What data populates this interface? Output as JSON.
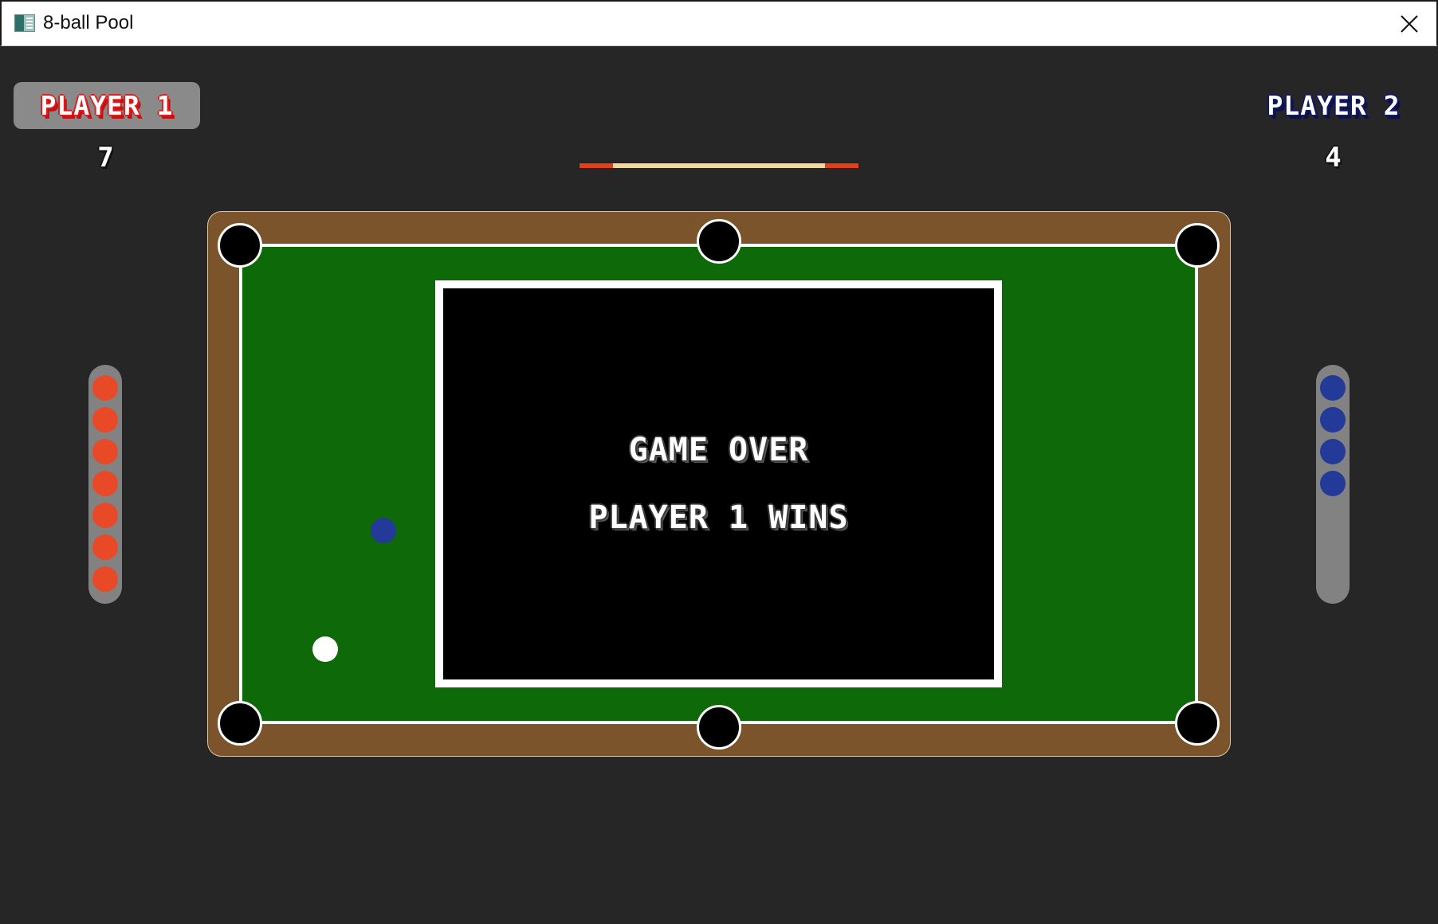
{
  "window": {
    "title": "8-ball Pool",
    "icon": "app-icon",
    "close_icon": "close-icon"
  },
  "players": [
    {
      "name": "PLAYER 1",
      "score": "7",
      "active": true,
      "ball_color": "#e84a27",
      "balls_pocketed": 7
    },
    {
      "name": "PLAYER 2",
      "score": "4",
      "active": false,
      "ball_color": "#233a98",
      "balls_pocketed": 4
    }
  ],
  "overlay": {
    "line1": "GAME OVER",
    "line2": "PLAYER 1 WINS"
  },
  "colors": {
    "background": "#262626",
    "felt": "#0e6a08",
    "rail": "#7b542c",
    "player1": "#e84a27",
    "player2": "#233a98",
    "cue_ball": "#ffffff"
  },
  "table_balls": [
    {
      "kind": "blue",
      "color": "#233a98"
    },
    {
      "kind": "cue",
      "color": "#ffffff"
    }
  ],
  "pockets": [
    "top-left",
    "top-middle",
    "top-right",
    "bottom-left",
    "bottom-middle",
    "bottom-right"
  ]
}
